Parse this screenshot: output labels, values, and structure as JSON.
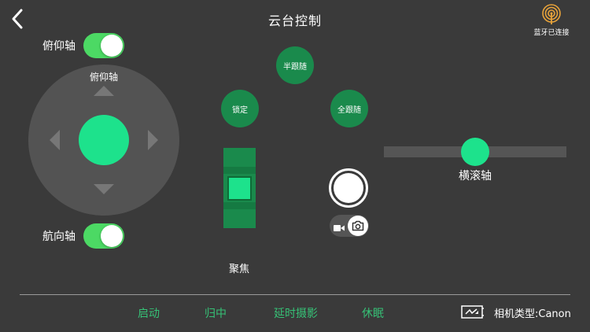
{
  "header": {
    "title": "云台控制",
    "bluetooth_status": "蓝牙已连接"
  },
  "colors": {
    "background": "#3a3a3a",
    "accent_green": "#1de28c",
    "dark_green": "#1a8a4c",
    "toggle_on": "#4cd964",
    "action_text": "#36c176"
  },
  "toggles": {
    "pitch": {
      "label": "俯仰轴",
      "on": true
    },
    "yaw": {
      "label": "航向轴",
      "on": true
    }
  },
  "joystick": {
    "caption": "俯仰轴"
  },
  "follow_modes": {
    "half_follow": "半跟随",
    "lock": "锁定",
    "full_follow": "全跟随"
  },
  "focus": {
    "label": "聚焦"
  },
  "roll": {
    "label": "横滚轴"
  },
  "capture_mode": {
    "selected": "photo"
  },
  "bottom_bar": {
    "start": "启动",
    "center": "归中",
    "timelapse": "延时摄影",
    "sleep": "休眠",
    "camera_type": "相机类型:Canon"
  },
  "icons": [
    "back-chevron-icon",
    "bluetooth-signal-icon",
    "video-camera-icon",
    "photo-camera-icon",
    "camera-trigger-icon"
  ]
}
